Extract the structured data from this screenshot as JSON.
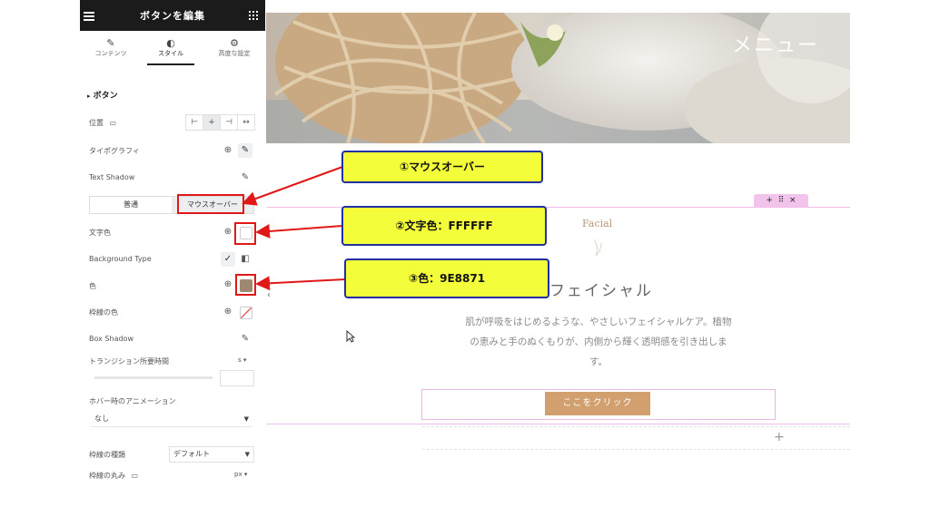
{
  "panel": {
    "title": "ボタンを編集",
    "tabs": [
      {
        "label": "コンテンツ",
        "icon": "pencil-icon"
      },
      {
        "label": "スタイル",
        "icon": "contrast-icon"
      },
      {
        "label": "高度な設定",
        "icon": "gear-icon"
      }
    ],
    "section_title": "ボタン",
    "rows": {
      "position": "位置",
      "typography": "タイポグラフィ",
      "text_shadow": "Text Shadow",
      "text_color": "文字色",
      "background_type": "Background Type",
      "color": "色",
      "border_color": "枠線の色",
      "box_shadow": "Box Shadow",
      "transition": "トランジション所要時間",
      "transition_unit": "s",
      "hover_animation": "ホバー時のアニメーション",
      "hover_animation_value": "なし",
      "border_type": "枠線の種類",
      "border_type_value": "デフォルト",
      "border_radius": "枠線の丸み",
      "border_radius_unit": "px"
    },
    "state_tabs": {
      "normal": "普通",
      "hover": "マウスオーバー"
    },
    "colors": {
      "text_color": "#FFFFFF",
      "bg_color": "#9E8871"
    }
  },
  "preview": {
    "hero_text": "メニュー",
    "subtitle": "Facial",
    "heading": "フェイシャル",
    "description": [
      "肌が呼吸をはじめるような、やさしいフェイシャルケア。植物",
      "の恵みと手のぬくもりが、内側から輝く透明感を引き出しま",
      "す。"
    ],
    "button_label": "ここをクリック",
    "toolbar": {
      "add": "+",
      "move": "⠿",
      "close": "×"
    },
    "add_section": "+"
  },
  "callouts": [
    {
      "text": "①マウスオーバー"
    },
    {
      "text": "②文字色：FFFFFF"
    },
    {
      "text": "③色：9E8871"
    }
  ]
}
